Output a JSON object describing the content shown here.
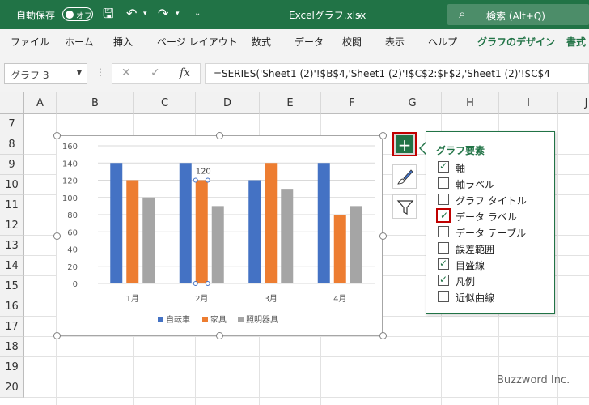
{
  "titlebar": {
    "autosave_label": "自動保存",
    "autosave_state": "オフ",
    "file_name": "Excelグラフ.xlsx",
    "search_text": "検索 (Alt+Q)"
  },
  "ribbon": {
    "tabs": [
      "ファイル",
      "ホーム",
      "挿入",
      "ページ レイアウト",
      "数式",
      "データ",
      "校閲",
      "表示",
      "ヘルプ",
      "グラフのデザイン",
      "書式"
    ]
  },
  "formula_bar": {
    "name_box": "グラフ 3",
    "fx_label": "fx",
    "formula": "=SERIES('Sheet1 (2)'!$B$4,'Sheet1 (2)'!$C$2:$F$2,'Sheet1 (2)'!$C$4"
  },
  "sheet": {
    "columns": [
      "A",
      "B",
      "C",
      "D",
      "E",
      "F",
      "G",
      "H",
      "I",
      "J"
    ],
    "rows": [
      "7",
      "8",
      "9",
      "10",
      "11",
      "12",
      "13",
      "14",
      "15",
      "16",
      "17",
      "18",
      "19",
      "20"
    ]
  },
  "chart_data": {
    "type": "bar",
    "categories": [
      "1月",
      "2月",
      "3月",
      "4月"
    ],
    "series": [
      {
        "name": "自転車",
        "values": [
          140,
          140,
          120,
          140
        ],
        "color": "#4472c4"
      },
      {
        "name": "家具",
        "values": [
          120,
          120,
          140,
          80
        ],
        "color": "#ed7d31"
      },
      {
        "name": "照明器具",
        "values": [
          100,
          90,
          110,
          90
        ],
        "color": "#a5a5a5"
      }
    ],
    "ylim": [
      0,
      160
    ],
    "yticks": [
      "0",
      "20",
      "40",
      "60",
      "80",
      "100",
      "120",
      "140",
      "160"
    ],
    "data_label": {
      "series": 1,
      "category": 1,
      "text": "120"
    },
    "grid": true,
    "legend": "bottom"
  },
  "chart_elements": {
    "title": "グラフ要素",
    "items": [
      {
        "label": "軸",
        "checked": true
      },
      {
        "label": "軸ラベル",
        "checked": false
      },
      {
        "label": "グラフ タイトル",
        "checked": false
      },
      {
        "label": "データ ラベル",
        "checked": true
      },
      {
        "label": "データ テーブル",
        "checked": false
      },
      {
        "label": "誤差範囲",
        "checked": false
      },
      {
        "label": "目盛線",
        "checked": true
      },
      {
        "label": "凡例",
        "checked": true
      },
      {
        "label": "近似曲線",
        "checked": false
      }
    ]
  },
  "watermark": "Buzzword Inc."
}
